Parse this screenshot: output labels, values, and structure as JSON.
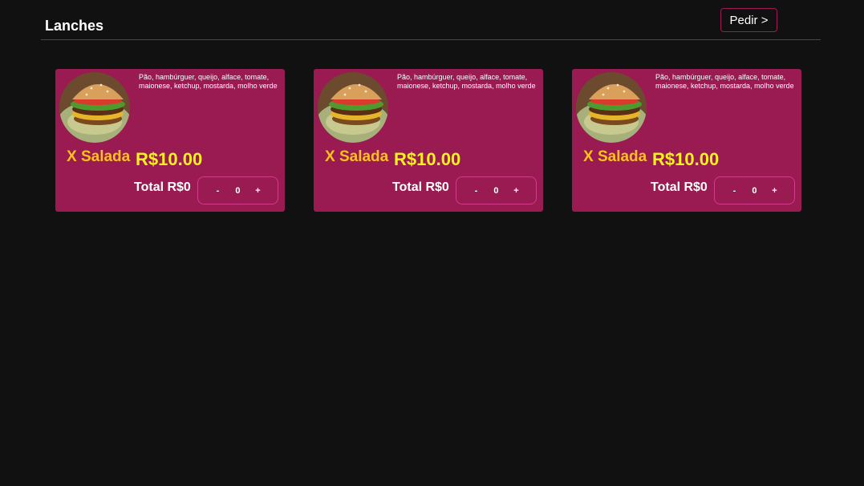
{
  "header": {
    "title": "Lanches",
    "order_label": "Pedir >"
  },
  "colors": {
    "background": "#111111",
    "card": "#9a1a52",
    "accent_line": "#9b1b52",
    "name": "#ffc21a",
    "price": "#f6f21f"
  },
  "products": [
    {
      "description": "Pão, hambúrguer, queijo, alface, tomate, maionese, ketchup, mostarda, molho verde",
      "name": "X Salada",
      "price": "R$10.00",
      "total": "Total R$0",
      "minus": "-",
      "quantity": "0",
      "plus": "+"
    },
    {
      "description": "Pão, hambúrguer, queijo, alface, tomate, maionese, ketchup, mostarda, molho verde",
      "name": "X Salada",
      "price": "R$10.00",
      "total": "Total R$0",
      "minus": "-",
      "quantity": "0",
      "plus": "+"
    },
    {
      "description": "Pão, hambúrguer, queijo, alface, tomate, maionese, ketchup, mostarda, molho verde",
      "name": "X Salada",
      "price": "R$10.00",
      "total": "Total R$0",
      "minus": "-",
      "quantity": "0",
      "plus": "+"
    }
  ]
}
